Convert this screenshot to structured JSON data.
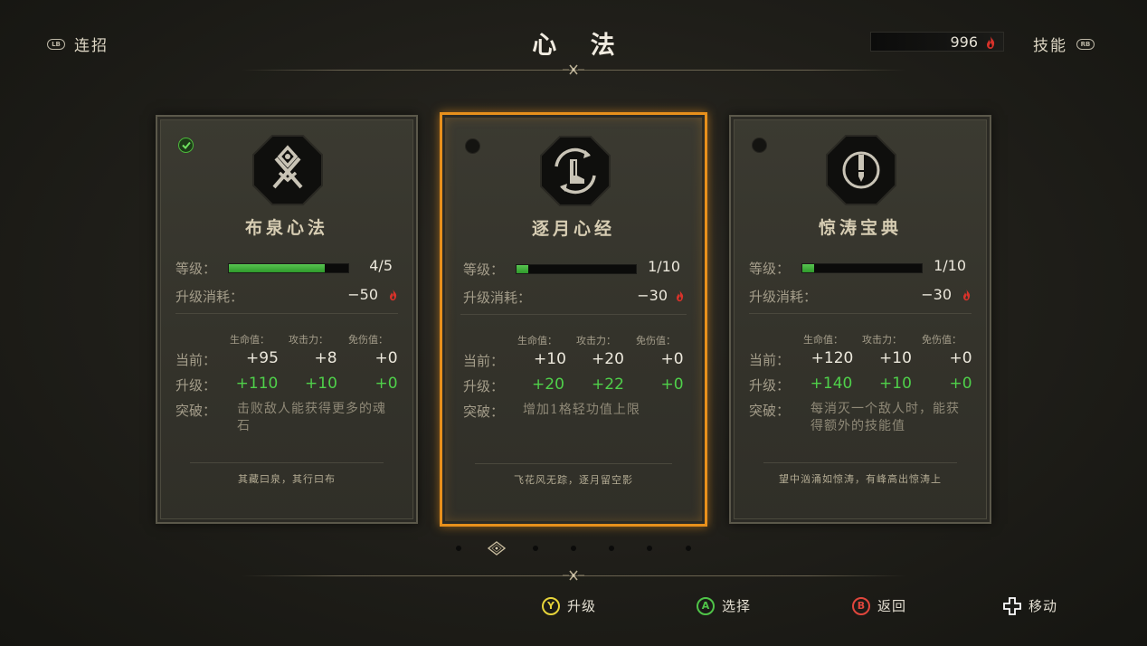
{
  "header": {
    "title": "心 法",
    "left_nav": {
      "button": "LB",
      "label": "连招"
    },
    "right_nav": {
      "button": "RB",
      "label": "技能"
    },
    "currency": {
      "value": "996",
      "icon": "flame-icon"
    }
  },
  "labels": {
    "level": "等级：",
    "upgrade_cost": "升级消耗：",
    "col_hp": "生命值：",
    "col_atk": "攻击力：",
    "col_def": "免伤值：",
    "current": "当前：",
    "upgrade": "升级：",
    "breakthrough": "突破："
  },
  "cards": [
    {
      "name": "布泉心法",
      "emblem": "crossed-swords-emblem-icon",
      "equipped": true,
      "selected": false,
      "level": "4/5",
      "level_progress": 0.8,
      "cost": "−50",
      "current": [
        "+95",
        "+8",
        "+0"
      ],
      "upgrade": [
        "+110",
        "+10",
        "+0"
      ],
      "breakthrough": "击败敌人能获得更多的魂石",
      "quote": "其藏曰泉，其行曰布"
    },
    {
      "name": "逐月心经",
      "emblem": "boot-cycle-emblem-icon",
      "equipped": false,
      "selected": true,
      "level": "1/10",
      "level_progress": 0.1,
      "cost": "−30",
      "current": [
        "+10",
        "+20",
        "+0"
      ],
      "upgrade": [
        "+20",
        "+22",
        "+0"
      ],
      "breakthrough": "增加1格轻功值上限",
      "quote": "飞花风无踪，逐月留空影"
    },
    {
      "name": "惊涛宝典",
      "emblem": "sword-circle-emblem-icon",
      "equipped": false,
      "selected": false,
      "level": "1/10",
      "level_progress": 0.1,
      "cost": "−30",
      "current": [
        "+120",
        "+10",
        "+0"
      ],
      "upgrade": [
        "+140",
        "+10",
        "+0"
      ],
      "breakthrough": "每消灭一个敌人时，能获得额外的技能值",
      "quote": "望中汹涌如惊涛，有峰高出惊涛上"
    }
  ],
  "pager": {
    "count": 7,
    "active": 1
  },
  "footer": [
    {
      "button": "Y",
      "label": "升级",
      "color": "#e6d33a"
    },
    {
      "button": "A",
      "label": "选择",
      "color": "#4fc448"
    },
    {
      "button": "B",
      "label": "返回",
      "color": "#e0463c"
    },
    {
      "button": "dpad",
      "label": "移动",
      "color": "#ffffff"
    }
  ],
  "colors": {
    "selected_border": "#e8901c",
    "stat_up": "#4fd04a",
    "bar_fill": "#3fae3a",
    "flame": "#d8322a"
  }
}
